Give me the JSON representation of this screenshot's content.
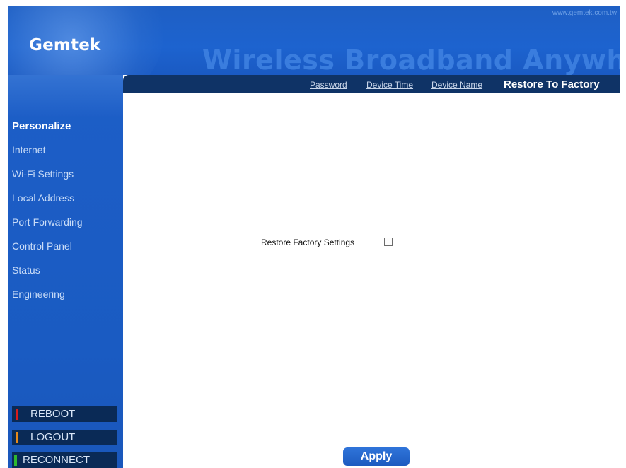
{
  "header": {
    "logo": "Gemtek",
    "site_url": "www.gemtek.com.tw",
    "tagline": "Wireless Broadband Anywhere"
  },
  "tabs": [
    {
      "label": "Password",
      "current": false
    },
    {
      "label": "Device Time",
      "current": false
    },
    {
      "label": "Device Name",
      "current": false
    },
    {
      "label": "Restore To Factory",
      "current": true
    }
  ],
  "sidebar": {
    "items": [
      {
        "label": "Personalize",
        "active": true
      },
      {
        "label": "Internet",
        "active": false
      },
      {
        "label": "Wi-Fi Settings",
        "active": false
      },
      {
        "label": "Local Address",
        "active": false
      },
      {
        "label": "Port Forwarding",
        "active": false
      },
      {
        "label": "Control Panel",
        "active": false
      },
      {
        "label": "Status",
        "active": false
      },
      {
        "label": "Engineering",
        "active": false
      }
    ],
    "buttons": [
      {
        "label": "REBOOT",
        "led_color": "#d81c1c"
      },
      {
        "label": "LOGOUT",
        "led_color": "#e88a1a"
      },
      {
        "label": "RECONNECT",
        "led_color": "#2fb82f"
      }
    ]
  },
  "main": {
    "restore_label": "Restore Factory Settings",
    "restore_checked": false,
    "apply_label": "Apply"
  },
  "colors": {
    "brand_blue": "#1d5ec7",
    "tabbar_navy": "#0f3366",
    "button_navy": "#0a2a56"
  }
}
